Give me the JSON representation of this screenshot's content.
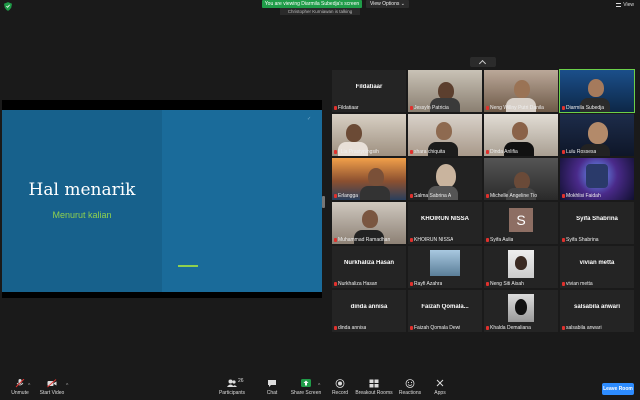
{
  "top": {
    "share_banner": "You are viewing Diarmila Subedja's screen",
    "view_options": "View Options ⌄",
    "speaking": "Christopher Kurniawan is talking",
    "view_label": "View"
  },
  "slide": {
    "title": "Hal menarik",
    "subtitle": "Menurut kalian"
  },
  "participants": [
    {
      "name": "Fildatiaar",
      "type": "name",
      "label": "Fildatiaar"
    },
    {
      "name": "Jessyln Patricia",
      "type": "video"
    },
    {
      "name": "Neng Willny Putri Danila",
      "type": "video"
    },
    {
      "name": "Diarmila Subedja",
      "type": "video",
      "speaker": true
    },
    {
      "name": "I Lia Prastyningsih",
      "type": "video"
    },
    {
      "name": "shara chiquita",
      "type": "video"
    },
    {
      "name": "Dinda Anlifia",
      "type": "video"
    },
    {
      "name": "Lulu Rossesa",
      "type": "video"
    },
    {
      "name": "Erlangga",
      "type": "video"
    },
    {
      "name": "Salma Sabrina A",
      "type": "video"
    },
    {
      "name": "Michelle Angeline Tio",
      "type": "video"
    },
    {
      "name": "Mokhlisi Faidah",
      "type": "video"
    },
    {
      "name": "Muhammad Ramadhan",
      "type": "video"
    },
    {
      "name": "KHOIRUN NISSA",
      "type": "name",
      "label": "KHOIRUN NISSA"
    },
    {
      "name": "Syifa Aulia",
      "type": "avatar",
      "initial": "S"
    },
    {
      "name": "Syifa Shabrina",
      "type": "name",
      "label": "Syifa Shabrina"
    },
    {
      "name": "Nurkhaliza Hasan",
      "type": "name",
      "label": "Nurkhaliza Hasan"
    },
    {
      "name": "Rayfi Azahra",
      "type": "photo"
    },
    {
      "name": "Neng Siti Aisah",
      "type": "photo"
    },
    {
      "name": "vivian metta",
      "type": "name",
      "label": "vivian metta"
    },
    {
      "name": "dinda annisa",
      "type": "name",
      "label": "dinda annisa"
    },
    {
      "name": "Faizah Qomala Dewi",
      "type": "name",
      "label": "Faizah Qomala..."
    },
    {
      "name": "Khalda Demaliana",
      "type": "photo"
    },
    {
      "name": "salsabila anwari",
      "type": "name",
      "label": "salsabila anwari"
    }
  ],
  "toolbar": {
    "unmute": "Unmute",
    "start_video": "Start Video",
    "participants": "Participants",
    "participants_count": "26",
    "chat": "Chat",
    "share_screen": "Share Screen",
    "record": "Record",
    "breakout": "Breakout Rooms",
    "reactions": "Reactions",
    "apps": "Apps",
    "leave": "Leave Room"
  },
  "colors": {
    "accent": "#2d8cff",
    "share_green": "#1f9c48",
    "slide_bg": "#17618c",
    "slide_sub": "#8fd14f"
  }
}
